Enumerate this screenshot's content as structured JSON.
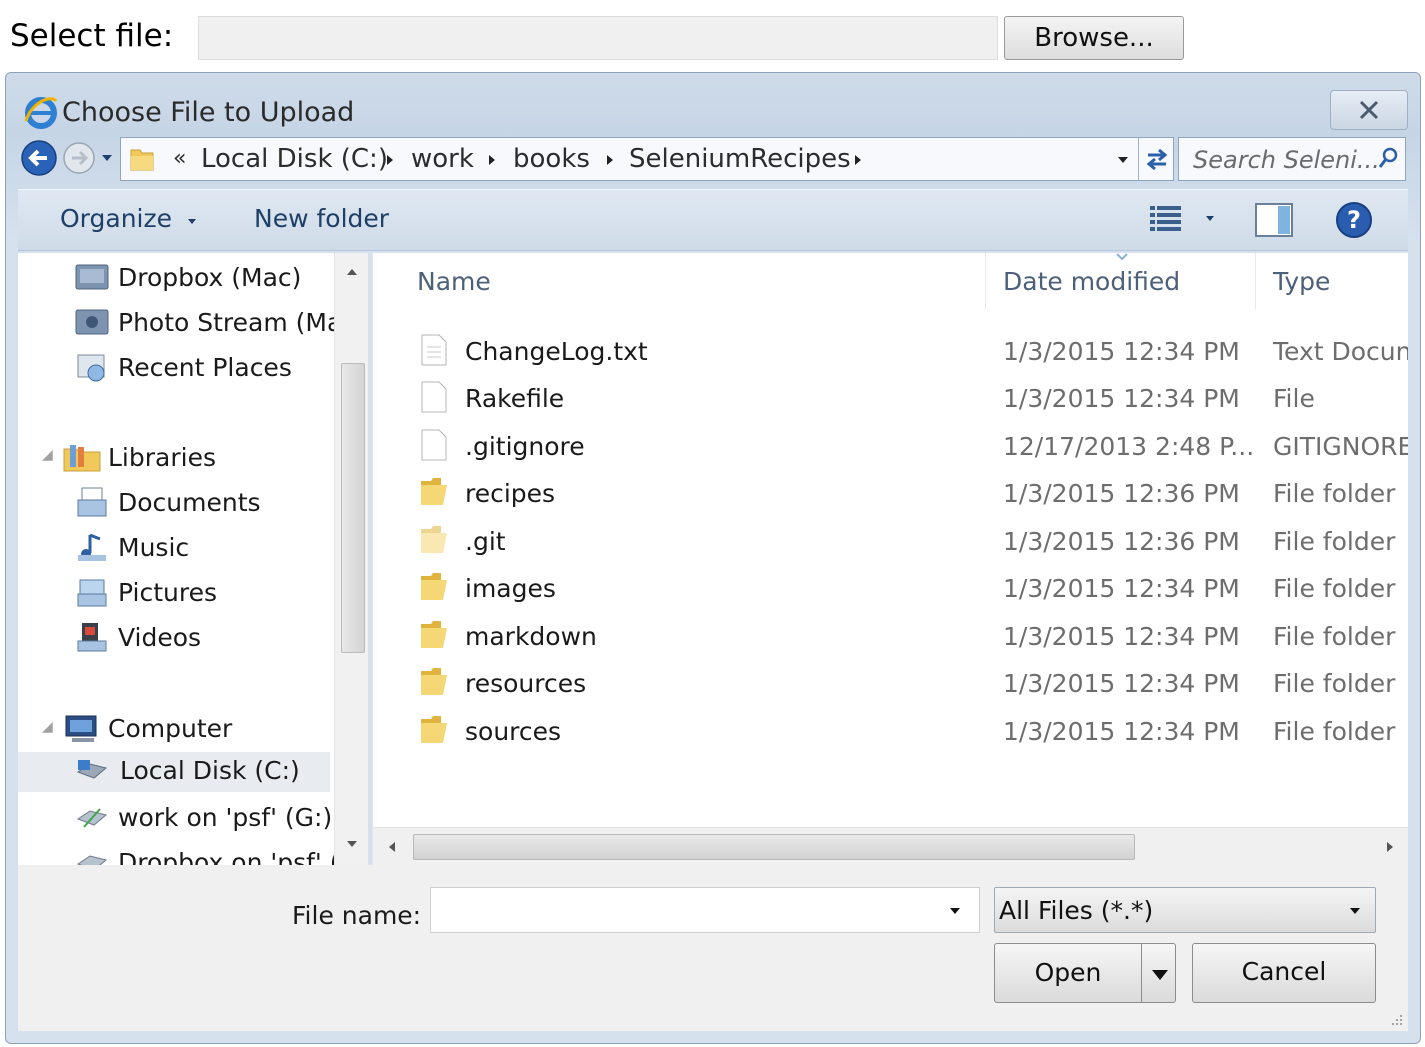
{
  "page": {
    "select_label": "Select file:",
    "select_value": "",
    "browse_label": "Browse..."
  },
  "dialog": {
    "title": "Choose File to Upload",
    "address": {
      "overflow": "«",
      "crumbs": [
        "Local Disk (C:)",
        "work",
        "books",
        "SeleniumRecipes"
      ]
    },
    "search_placeholder": "Search Seleni...",
    "toolbar": {
      "organize": "Organize",
      "new_folder": "New folder"
    },
    "nav": {
      "items": [
        {
          "label": "Dropbox (Mac)",
          "icon": "dropbox-icon"
        },
        {
          "label": "Photo Stream (Ma",
          "icon": "photo-stream-icon"
        },
        {
          "label": "Recent Places",
          "icon": "recent-places-icon"
        },
        {
          "label": "Libraries",
          "icon": "libraries-icon"
        },
        {
          "label": "Documents",
          "icon": "documents-icon"
        },
        {
          "label": "Music",
          "icon": "music-icon"
        },
        {
          "label": "Pictures",
          "icon": "pictures-icon"
        },
        {
          "label": "Videos",
          "icon": "videos-icon"
        },
        {
          "label": "Computer",
          "icon": "computer-icon"
        },
        {
          "label": "Local Disk (C:)",
          "icon": "local-disk-icon"
        },
        {
          "label": "work on 'psf' (G:)",
          "icon": "network-drive-icon"
        },
        {
          "label": "Dropbox on 'psf' (",
          "icon": "network-drive-icon"
        }
      ]
    },
    "columns": {
      "name": "Name",
      "date": "Date modified",
      "type": "Type"
    },
    "files": [
      {
        "name": "ChangeLog.txt",
        "date": "1/3/2015 12:34 PM",
        "type": "Text Docun",
        "icon": "text-file-icon"
      },
      {
        "name": "Rakefile",
        "date": "1/3/2015 12:34 PM",
        "type": "File",
        "icon": "file-icon"
      },
      {
        "name": ".gitignore",
        "date": "12/17/2013 2:48 P...",
        "type": "GITIGNORE",
        "icon": "file-icon"
      },
      {
        "name": "recipes",
        "date": "1/3/2015 12:36 PM",
        "type": "File folder",
        "icon": "folder-icon"
      },
      {
        "name": ".git",
        "date": "1/3/2015 12:36 PM",
        "type": "File folder",
        "icon": "folder-icon"
      },
      {
        "name": "images",
        "date": "1/3/2015 12:34 PM",
        "type": "File folder",
        "icon": "folder-icon"
      },
      {
        "name": "markdown",
        "date": "1/3/2015 12:34 PM",
        "type": "File folder",
        "icon": "folder-icon"
      },
      {
        "name": "resources",
        "date": "1/3/2015 12:34 PM",
        "type": "File folder",
        "icon": "folder-icon"
      },
      {
        "name": "sources",
        "date": "1/3/2015 12:34 PM",
        "type": "File folder",
        "icon": "folder-icon"
      }
    ],
    "file_name_label": "File name:",
    "file_name_value": "",
    "filter": "All Files (*.*)",
    "open_label": "Open",
    "cancel_label": "Cancel"
  }
}
